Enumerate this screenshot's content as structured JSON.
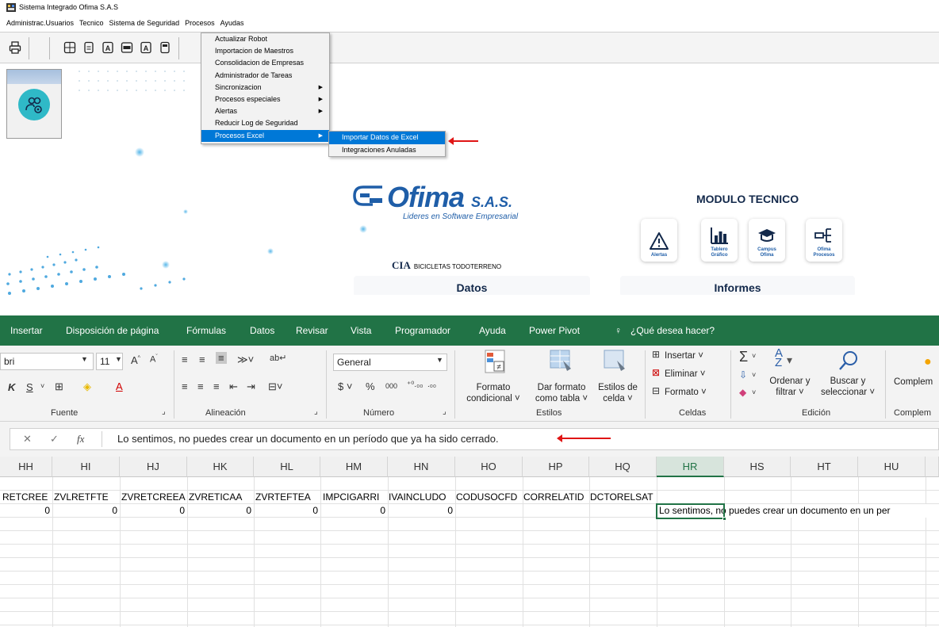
{
  "ofima": {
    "window_title": "Sistema Integrado Ofima S.A.S",
    "menu": [
      "Administrac.Usuarios",
      "Tecnico",
      "Sistema de Seguridad",
      "Procesos",
      "Ayudas"
    ],
    "procesos_menu": [
      {
        "label": "Actualizar Robot",
        "submenu": false
      },
      {
        "label": "Importacion de Maestros",
        "submenu": false
      },
      {
        "label": "Consolidacion de Empresas",
        "submenu": false
      },
      {
        "label": "Administrador de Tareas",
        "submenu": false
      },
      {
        "label": "Sincronizacion",
        "submenu": true
      },
      {
        "label": "Procesos especiales",
        "submenu": true
      },
      {
        "label": "Alertas",
        "submenu": true
      },
      {
        "label": "Reducir Log de Seguridad",
        "submenu": false
      },
      {
        "label": "Procesos Excel",
        "submenu": true
      }
    ],
    "procesos_excel_submenu": [
      "Importar Datos de Excel",
      "Integraciones Anuladas"
    ],
    "logo_brand": "Ofima",
    "logo_suffix": "S.A.S.",
    "logo_tagline": "Lideres en Software Empresarial",
    "cia_label": "CIA",
    "cia_name": "BICICLETAS TODOTERRENO",
    "modulo_title": "MODULO TECNICO",
    "module_cards": [
      {
        "label": "Alertas",
        "icon": "warning-icon"
      },
      {
        "label": "Tablero\nGráfico",
        "icon": "bar-chart-icon"
      },
      {
        "label": "Campus\nOfima",
        "icon": "graduation-cap-icon"
      },
      {
        "label": "Ofima\nProcesos",
        "icon": "process-tree-icon"
      }
    ],
    "section_datos": "Datos",
    "section_informes": "Informes",
    "accent": "#0078d7"
  },
  "excel": {
    "tabs": [
      "Insertar",
      "Disposición de página",
      "Fórmulas",
      "Datos",
      "Revisar",
      "Vista",
      "Programador",
      "Ayuda",
      "Power Pivot",
      "¿Qué desea hacer?"
    ],
    "font_name": "bri",
    "font_size": "11",
    "number_format": "General",
    "groups": [
      "Fuente",
      "Alineación",
      "Número",
      "Estilos",
      "Celdas",
      "Edición",
      "Complem"
    ],
    "labels": {
      "formato_condicional": "Formato\ncondicional ˅",
      "dar_formato": "Dar formato\ncomo tabla ˅",
      "estilos_celda": "Estilos de\ncelda ˅",
      "insertar": "Insertar",
      "eliminar": "Eliminar",
      "formato": "Formato",
      "ordenar": "Ordenar y\nfiltrar ˅",
      "buscar": "Buscar y\nseleccionar ˅",
      "complem": "Complem"
    },
    "formula_text": "Lo sentimos, no puedes crear un documento en un período que ya ha sido cerrado.",
    "columns": [
      "HH",
      "HI",
      "HJ",
      "HK",
      "HL",
      "HM",
      "HN",
      "HO",
      "HP",
      "HQ",
      "HR",
      "HS",
      "HT",
      "HU"
    ],
    "selected_column": "HR",
    "header_row": [
      "RETCREE",
      "ZVLRETFTE",
      "ZVRETCREEA",
      "ZVRETICAA",
      "ZVRTEFTEA",
      "IMPCIGARRI",
      "IVAINCLUDO",
      "CODUSOCFD",
      "CORRELATID",
      "DCTORELSAT"
    ],
    "value_row": [
      "0",
      "0",
      "0",
      "0",
      "0",
      "0",
      "0"
    ],
    "hr_cell_text": "Lo sentimos, no puedes crear un documento en un per",
    "brand_green": "#217346"
  }
}
